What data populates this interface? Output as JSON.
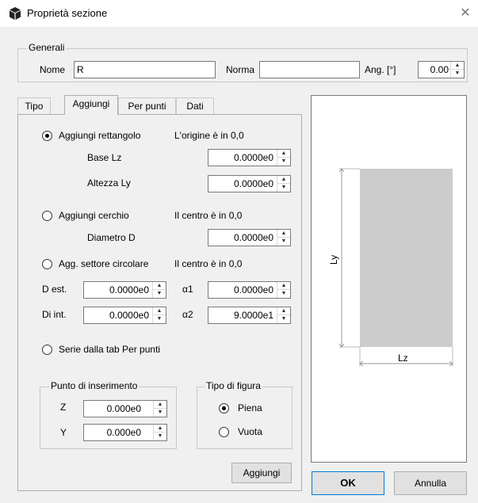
{
  "window": {
    "title": "Proprietà sezione",
    "icon": "cube-icon",
    "close_icon": "close-icon"
  },
  "generali": {
    "legend": "Generali",
    "nome_label": "Nome",
    "nome_value": "R",
    "norma_label": "Norma",
    "norma_value": "",
    "ang_label": "Ang. [°]",
    "ang_value": "0.00"
  },
  "tabs": [
    {
      "label": "Tipo",
      "active": false
    },
    {
      "label": "Aggiungi",
      "active": true
    },
    {
      "label": "Per punti",
      "active": false
    },
    {
      "label": "Dati",
      "active": false
    }
  ],
  "aggiungi": {
    "rettangolo": {
      "label": "Aggiungi rettangolo",
      "checked": true,
      "note": "L'origine è in 0,0",
      "base_label": "Base Lz",
      "base_value": "0.0000e0",
      "altezza_label": "Altezza Ly",
      "altezza_value": "0.0000e0"
    },
    "cerchio": {
      "label": "Aggiungi cerchio",
      "checked": false,
      "note": "Il centro è in 0,0",
      "diametro_label": "Diametro D",
      "diametro_value": "0.0000e0"
    },
    "settore": {
      "label": "Agg. settore circolare",
      "checked": false,
      "note": "Il centro è in 0,0",
      "dest_label": "D est.",
      "dest_value": "0.0000e0",
      "dint_label": "Di int.",
      "dint_value": "0.0000e0",
      "alpha1_label": "α1",
      "alpha1_value": "0.0000e0",
      "alpha2_label": "α2",
      "alpha2_value": "9.0000e1"
    },
    "serie": {
      "label": "Serie dalla tab Per punti",
      "checked": false
    },
    "punto": {
      "legend": "Punto di inserimento",
      "z_label": "Z",
      "z_value": "0.000e0",
      "y_label": "Y",
      "y_value": "0.000e0"
    },
    "tipo_figura": {
      "legend": "Tipo di figura",
      "piena_label": "Piena",
      "piena_checked": true,
      "vuota_label": "Vuota",
      "vuota_checked": false
    },
    "add_button": "Aggiungi"
  },
  "preview": {
    "ly_label": "Ly",
    "lz_label": "Lz",
    "fill_color": "#cccccc"
  },
  "buttons": {
    "ok": "OK",
    "cancel": "Annulla"
  }
}
